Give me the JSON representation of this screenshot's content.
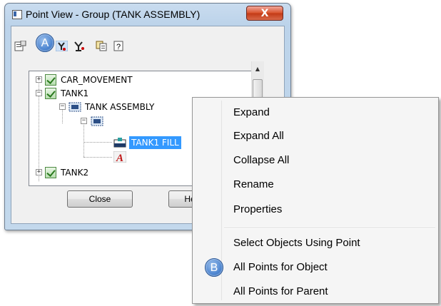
{
  "window": {
    "title": "Point View - Group (TANK ASSEMBLY)",
    "close_glyph": "X"
  },
  "toolbar": {
    "icons": [
      "properties-icon",
      "point-tree-icon",
      "group-icon",
      "copy-icon",
      "help-icon"
    ]
  },
  "callouts": {
    "a": "A",
    "b": "B"
  },
  "tree": {
    "items": [
      {
        "label": "CAR_MOVEMENT",
        "expander": "+"
      },
      {
        "label": "TANK1",
        "expander": "−"
      },
      {
        "label": "TANK ASSEMBLY",
        "expander": "−"
      },
      {
        "label": "",
        "expander": "−"
      },
      {
        "label": "TANK1 FILL",
        "selected": true
      },
      {
        "label": "",
        "icon": "text-a-icon"
      },
      {
        "label": "TANK2",
        "expander": "+"
      }
    ]
  },
  "buttons": {
    "close": "Close",
    "help": "He"
  },
  "scrollbar": {
    "up_glyph": "▲"
  },
  "context_menu": {
    "group1": [
      "Expand",
      "Expand All",
      "Collapse All",
      "Rename",
      "Properties"
    ],
    "group2": [
      "Select Objects Using Point",
      "All Points for Object",
      "All Points for Parent"
    ]
  },
  "colors": {
    "selection": "#3399ff",
    "callout": "#4d85d0",
    "title_close": "#d9552f"
  }
}
